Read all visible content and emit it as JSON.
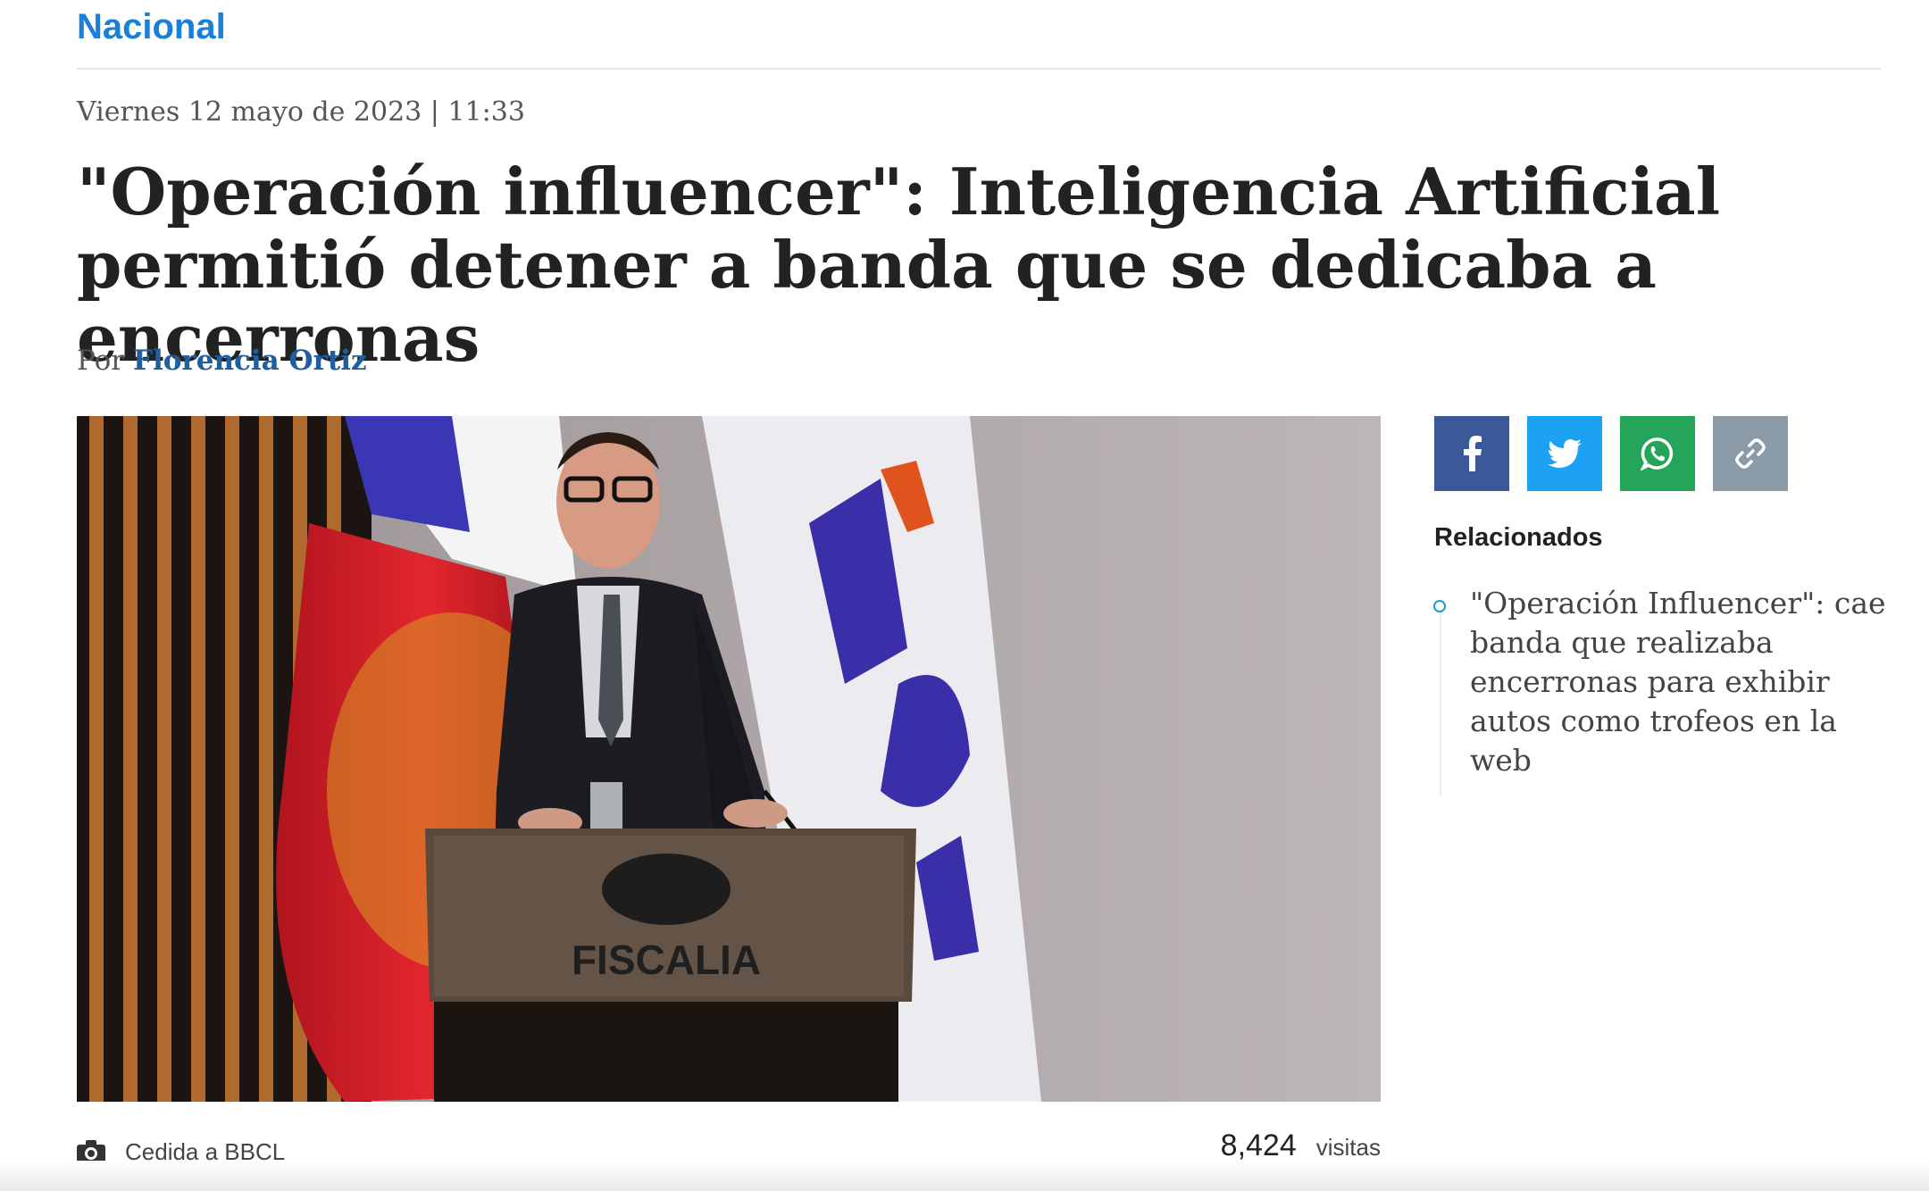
{
  "section": {
    "label": "Nacional"
  },
  "article": {
    "date": "Viernes 12 mayo de 2023 | 11:33",
    "title": "\"Operación influencer\": Inteligencia Artificial permitió detener a banda que se dedicaba a encerronas",
    "byline_prefix": "Por",
    "author": "Florencia Ortiz",
    "image": {
      "alt": "Fiscal en podio con logo FISCALIA y banderas",
      "podium_text": "FISCALIA"
    },
    "caption": "Cedida a BBCL",
    "visits_count": "8,424",
    "visits_label": "visitas"
  },
  "share": [
    {
      "name": "facebook",
      "icon": "facebook-icon",
      "color": "#3b5998"
    },
    {
      "name": "twitter",
      "icon": "twitter-icon",
      "color": "#1da1f2"
    },
    {
      "name": "whatsapp",
      "icon": "whatsapp-icon",
      "color": "#25a55a"
    },
    {
      "name": "copy-link",
      "icon": "link-icon",
      "color": "#8a9aa6"
    }
  ],
  "related": {
    "title": "Relacionados",
    "items": [
      {
        "text": "\"Operación Influencer\": cae banda que realizaba encerronas para exhibir autos como trofeos en la web"
      }
    ]
  }
}
